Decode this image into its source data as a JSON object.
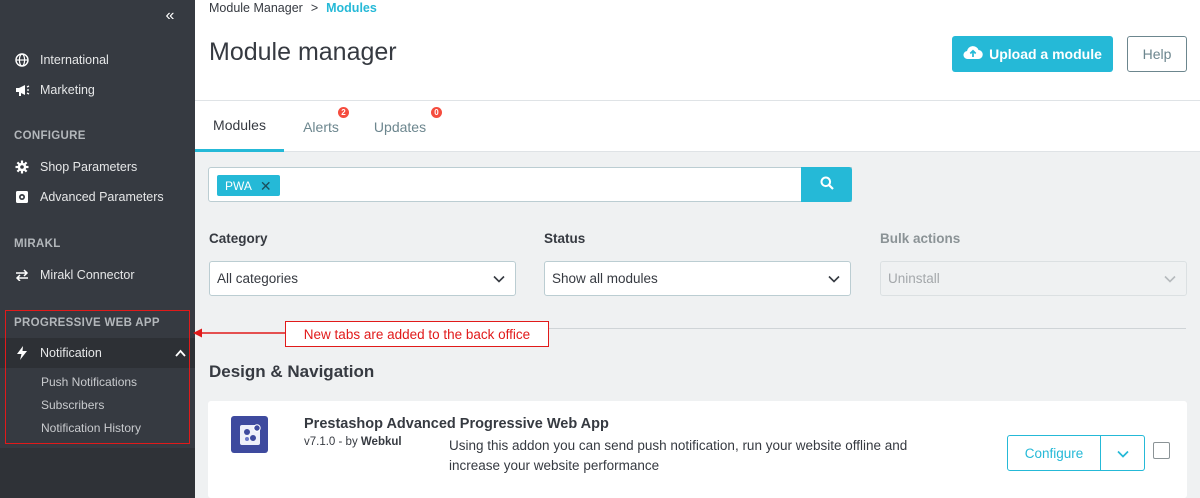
{
  "sidebar": {
    "items": [
      {
        "label": "International",
        "icon": "globe-icon"
      },
      {
        "label": "Marketing",
        "icon": "megaphone-icon"
      }
    ],
    "sections": {
      "configure": "CONFIGURE",
      "mirakl": "MIRAKL",
      "pwa": "PROGRESSIVE WEB APP"
    },
    "configure_items": [
      {
        "label": "Shop Parameters",
        "icon": "gear-icon"
      },
      {
        "label": "Advanced Parameters",
        "icon": "advanced-parameters-icon"
      }
    ],
    "mirakl_items": [
      {
        "label": "Mirakl Connector",
        "icon": "swap-arrows-icon"
      }
    ],
    "pwa_item": {
      "label": "Notification",
      "icon": "bolt-icon"
    },
    "pwa_subitems": [
      "Push Notifications",
      "Subscribers",
      "Notification History"
    ]
  },
  "breadcrumb": {
    "parent": "Module Manager",
    "separator": ">",
    "current": "Modules"
  },
  "header": {
    "title": "Module manager",
    "upload_label": "Upload a module",
    "help_label": "Help"
  },
  "tabs": [
    {
      "label": "Modules",
      "active": true
    },
    {
      "label": "Alerts",
      "badge": "2"
    },
    {
      "label": "Updates",
      "badge": "0"
    }
  ],
  "search": {
    "chip": "PWA"
  },
  "filters": {
    "category_label": "Category",
    "category_value": "All categories",
    "status_label": "Status",
    "status_value": "Show all modules",
    "bulk_label": "Bulk actions",
    "bulk_value": "Uninstall"
  },
  "annotation": "New tabs are added to the back office",
  "section_title": "Design & Navigation",
  "module": {
    "name": "Prestashop Advanced Progressive Web App",
    "version": "v7.1.0",
    "by": "- by",
    "author": "Webkul",
    "description": "Using this addon you can send push notification, run your website offline and increase your website performance",
    "configure_label": "Configure"
  },
  "colors": {
    "accent": "#25b9d7",
    "sidebar": "#363a41",
    "annotation": "#e11a1a",
    "badge": "#f54c3e"
  }
}
